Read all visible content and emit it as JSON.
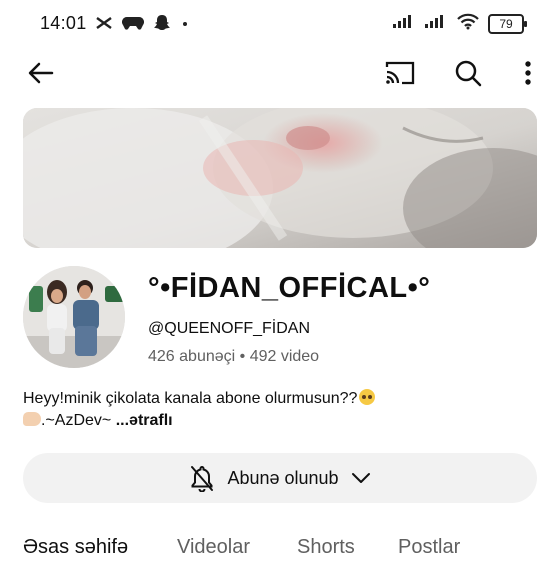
{
  "status_bar": {
    "time": "14:01",
    "battery": "79",
    "left_icons": [
      "capcut-icon",
      "gamepad-icon",
      "snapchat-icon",
      "dot-icon"
    ],
    "right_icons": [
      "signal-icon",
      "signal-icon",
      "wifi-icon",
      "battery-icon"
    ]
  },
  "top_bar": {
    "icons": [
      "back-arrow-icon",
      "cast-icon",
      "search-icon",
      "more-vert-icon"
    ]
  },
  "channel": {
    "name": "°•FİDAN_OFFİCAL•°",
    "handle": "@QUEENOFF_FİDAN",
    "subscribers": "426 abunəçi",
    "separator": " • ",
    "videos": "492 video",
    "description_line1": "Heyy!minik çikolata kanala abone olurmusun??",
    "description_line2": ".~AzDev~ ",
    "more_label": "...ətraflı"
  },
  "subscribe": {
    "label": "Abunə olunub"
  },
  "tabs": [
    "Əsas səhifə",
    "Videolar",
    "Shorts",
    "Postlar"
  ],
  "colors": {
    "text_primary": "#0f0f0f",
    "text_secondary": "#606060",
    "button_bg": "#f2f2f2"
  }
}
